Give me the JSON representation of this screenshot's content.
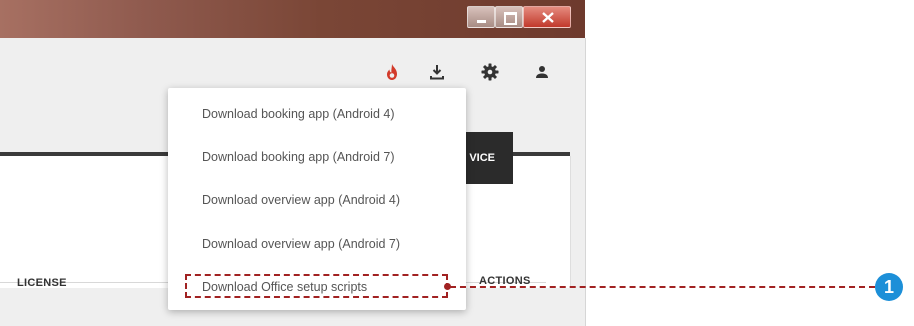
{
  "toolbar": {
    "icons": [
      "flame-icon",
      "download-icon",
      "gear-icon",
      "user-icon"
    ],
    "flame_color": "#d23a2a"
  },
  "device_button": {
    "label": "VICE"
  },
  "table": {
    "headers": {
      "license": "LICENSE",
      "actions": "ACTIONS"
    }
  },
  "menu": {
    "items": [
      {
        "label": "Download booking app (Android 4)"
      },
      {
        "label": "Download booking app (Android 7)"
      },
      {
        "label": "Download overview app (Android 4)"
      },
      {
        "label": "Download overview app (Android 7)"
      },
      {
        "label": "Download Office setup scripts"
      }
    ]
  },
  "callout": {
    "number": "1",
    "color": "#1c8fd8",
    "highlight_color": "#a12222"
  }
}
